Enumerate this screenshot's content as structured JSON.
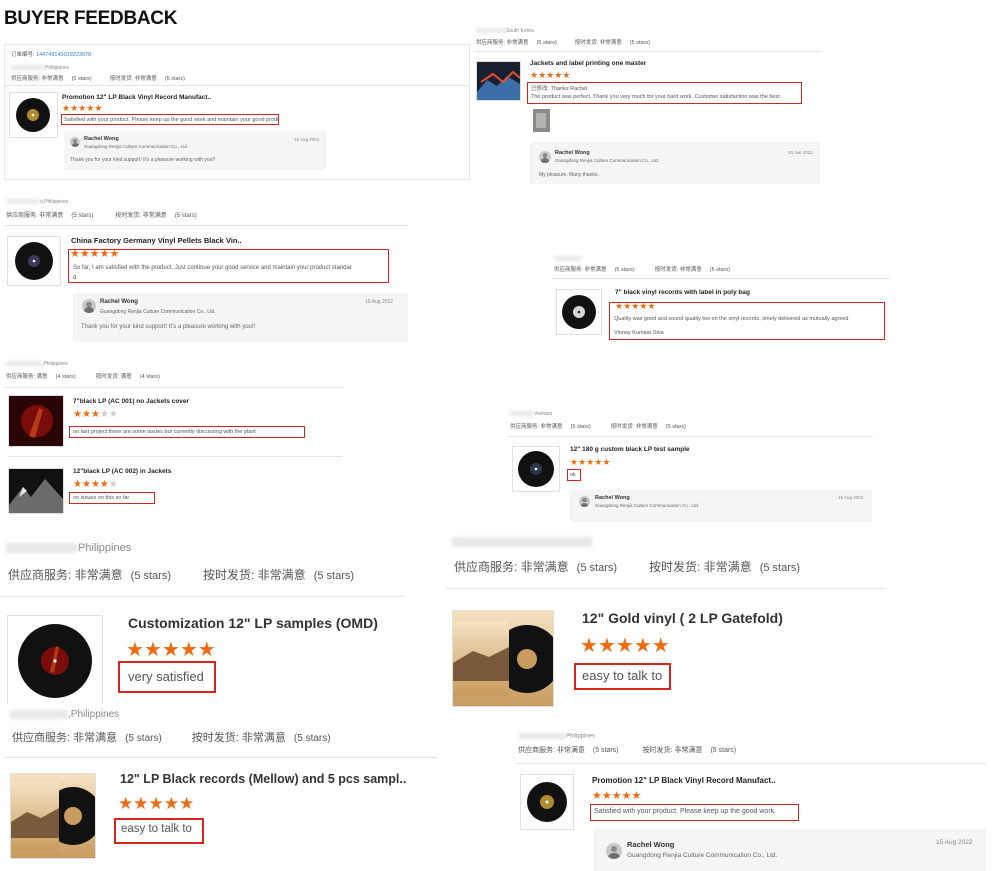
{
  "title": "BUYER FEEDBACK",
  "colors": {
    "star": "#f06a13",
    "highlight_border": "#d9231d",
    "reply_bg": "#f4f5f7",
    "link": "#2f7fd8"
  },
  "icons": {
    "star": "star-icon",
    "avatar": "avatar-icon"
  },
  "c1": {
    "order_label": "订单编号:",
    "order_no": "144749140019223678",
    "country": "Philippines",
    "service": "供应商服务: 非常满意",
    "service_stars": "(5 stars)",
    "delivery": "按时发货: 非常满意",
    "delivery_stars": "(5 stars)",
    "product": "Promotion 12\" LP Black Vinyl Record Manufact..",
    "rating": 5,
    "comment": "Satisfied with your product. Please keep up the good work and maintain your good product.",
    "reply_name": "Rachel Wong",
    "reply_company": "Guangdong Renjia Culture Communication Co., Ltd.",
    "reply_date": "15 Aug 2022",
    "reply_text": "Thank you for your kind support! It's a pleasure working with you!!"
  },
  "c2": {
    "country": "South Korea",
    "service": "供应商服务: 非常满意",
    "service_stars": "(5 stars)",
    "delivery": "按时发货: 非常满意",
    "delivery_stars": "(5 stars)",
    "product": "Jackets and label printing one master",
    "rating": 5,
    "comment_line1": "已修改: Thanks Rachel.",
    "comment_line2": "The product was perfect. Thank you very much for your hard work. Customer satisfaction was the best.",
    "reply_name": "Rachel Wong",
    "reply_company": "Guangdong Renjia Culture Communication Co., Ltd.",
    "reply_date": "20 Jan 2022",
    "reply_text": "My pleasure. Many thanks."
  },
  "c3": {
    "country": "o,Philippines",
    "service": "供应商服务: 非常满意",
    "service_stars": "(5 stars)",
    "delivery": "按时发货: 非常满意",
    "delivery_stars": "(5 stars)",
    "product": "China Factory Germany Vinyl Pellets Black Vin..",
    "rating": 5,
    "comment_line1": "So far, I am satisfied with the product. Just continue your good service and maintain your product standar",
    "comment_line2": "d",
    "reply_name": "Rachel Wong",
    "reply_company": "Guangdong Renjia Culture Communication Co., Ltd.",
    "reply_date": "15 Aug 2022",
    "reply_text": "Thank you for your kind support! It's a pleasure working with you!!"
  },
  "c4": {
    "country": "",
    "service": "供应商服务: 非常满意",
    "service_stars": "(5 stars)",
    "delivery": "按时发货: 非常满意",
    "delivery_stars": "(5 stars)",
    "product": "7\" black vinyl records with label in poly bag",
    "rating": 5,
    "comment_line1": "Quality was good and sound quality too on the vinyl records, timely delivered as mutually agreed",
    "comment_line2": "Vinnay Kumaar Siva"
  },
  "c5": {
    "country": "Philippines",
    "service": "供应商服务: 满意",
    "service_stars": "(4 stars)",
    "delivery": "按时发货: 满意",
    "delivery_stars": "(4 stars)",
    "items": [
      {
        "product": "7\"black LP (AC 001) no Jackets cover",
        "rating": 3,
        "comment": "on last project there are some issues but currently discussing with the plant"
      },
      {
        "product": "12\"black LP (AC 002) in Jackets",
        "rating": 4,
        "comment": "no issues on this so far"
      }
    ]
  },
  "c6": {
    "country": "Vietnam",
    "service": "供应商服务: 非常满意",
    "service_stars": "(5 stars)",
    "delivery": "按时发货: 非常满意",
    "delivery_stars": "(5 stars)",
    "product": "12\" 180 g custom black LP test sample",
    "rating": 5,
    "comment": "ok",
    "reply_name": "Rachel Wong",
    "reply_company": "Guangdong Renjia Culture Communication Co., Ltd.",
    "reply_date": "15 Aug 2022"
  },
  "c7": {
    "country": "Philippines",
    "service": "供应商服务: 非常满意",
    "service_stars": "(5 stars)",
    "delivery": "按时发货: 非常满意",
    "delivery_stars": "(5 stars)",
    "product": "Customization 12\" LP samples (OMD)",
    "rating": 5,
    "comment": "very satisfied"
  },
  "c8": {
    "service": "供应商服务: 非常满意",
    "service_stars": "(5 stars)",
    "delivery": "按时发货: 非常满意",
    "delivery_stars": "(5 stars)",
    "product": "12\" Gold vinyl ( 2 LP Gatefold)",
    "rating": 5,
    "comment": "easy to talk to"
  },
  "c9": {
    "country": ",Philippines",
    "service": "供应商服务: 非常满意",
    "service_stars": "(5 stars)",
    "delivery": "按时发货: 非常满意",
    "delivery_stars": "(5 stars)",
    "product": "12\" LP Black records (Mellow) and 5 pcs sampl..",
    "rating": 5,
    "comment": "easy to talk to"
  },
  "c10": {
    "country": "Philippines",
    "service": "供应商服务: 非常满意",
    "service_stars": "(5 stars)",
    "delivery": "按时发货: 非常满意",
    "delivery_stars": "(5 stars)",
    "product": "Promotion 12\" LP Black Vinyl Record Manufact..",
    "rating": 5,
    "comment": "Satisfied with your product. Please keep up the good work.",
    "reply_name": "Rachel Wong",
    "reply_company": "Guangdong Renjia Culture Communication Co., Ltd.",
    "reply_date": "15 Aug 2022"
  }
}
